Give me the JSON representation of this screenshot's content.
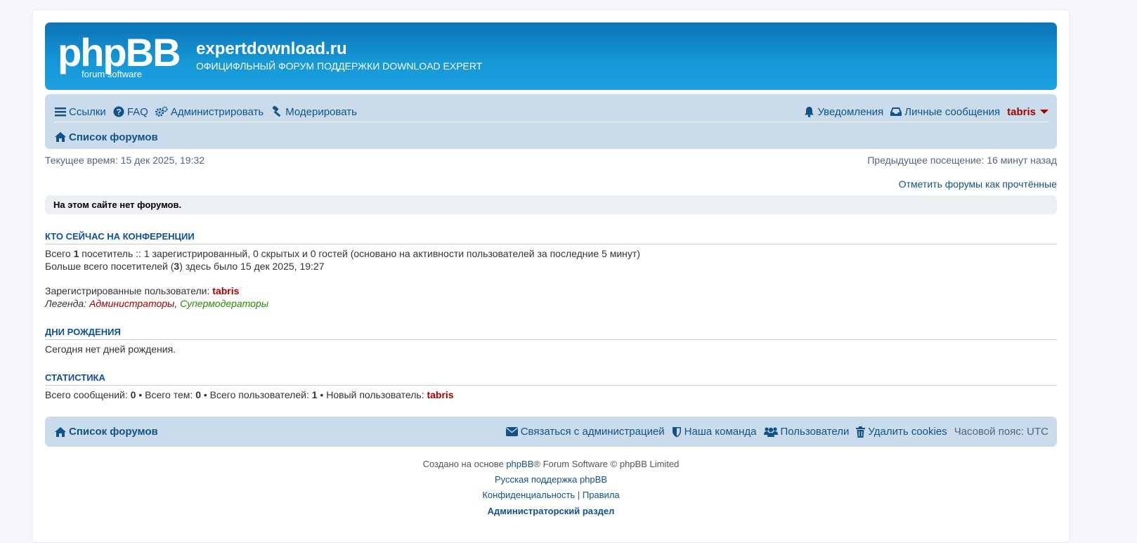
{
  "header": {
    "logo_main": "phpBB",
    "logo_sub": "forum software",
    "site_title": "expertdownload.ru",
    "site_description": "ОФИЦИФЛЬНЫЙ ФОРУМ ПОДДЕРЖКИ DOWNLOAD EXPERT"
  },
  "navbar": {
    "links": "Ссылки",
    "faq": "FAQ",
    "admin": "Администрировать",
    "moderate": "Модерировать",
    "notifications": "Уведомления",
    "pm": "Личные сообщения",
    "username": "tabris",
    "breadcrumb": "Список форумов"
  },
  "time": {
    "current": "Текущее время: 15 дек 2025, 19:32",
    "last_visit": "Предыдущее посещение: 16 минут назад"
  },
  "mark_read": "Отметить форумы как прочтённые",
  "no_forums": "На этом сайте нет форумов.",
  "online": {
    "title": "КТО СЕЙЧАС НА КОНФЕРЕНЦИИ",
    "line1_prefix": "Всего ",
    "line1_count": "1",
    "line1_rest": " посетитель :: 1 зарегистрированный, 0 скрытых и 0 гостей (основано на активности пользователей за последние 5 минут)",
    "line2_prefix": "Больше всего посетителей (",
    "line2_count": "3",
    "line2_rest": ") здесь было 15 дек 2025, 19:27",
    "registered_label": "Зарегистрированные пользователи: ",
    "registered_user": "tabris",
    "legend_label": "Легенда: ",
    "legend_admins": "Администраторы",
    "legend_sep": ", ",
    "legend_smods": "Супермодераторы"
  },
  "birthdays": {
    "title": "ДНИ РОЖДЕНИЯ",
    "text": "Сегодня нет дней рождения."
  },
  "stats": {
    "title": "СТАТИСТИКА",
    "posts_label": "Всего сообщений: ",
    "posts": "0",
    "topics_label": " • Всего тем: ",
    "topics": "0",
    "users_label": " • Всего пользователей: ",
    "users": "1",
    "newest_label": " • Новый пользователь: ",
    "newest": "tabris"
  },
  "footer_nav": {
    "breadcrumb": "Список форумов",
    "contact": "Связаться с администрацией",
    "team": "Наша команда",
    "members": "Пользователи",
    "delete_cookies": "Удалить cookies",
    "timezone": "Часовой пояс: UTC"
  },
  "copyright": {
    "line1_prefix": "Создано на основе ",
    "line1_link": "phpBB",
    "line1_rest": "® Forum Software © phpBB Limited",
    "line2": "Русская поддержка phpBB",
    "privacy": "Конфиденциальность",
    "sep": " | ",
    "terms": "Правила",
    "admin_panel": "Администраторский раздел"
  },
  "colors": {
    "header_gradient_top": "#0b74b6",
    "navbar_bg": "#cadceb",
    "link": "#105289",
    "username": "#aa0000"
  }
}
